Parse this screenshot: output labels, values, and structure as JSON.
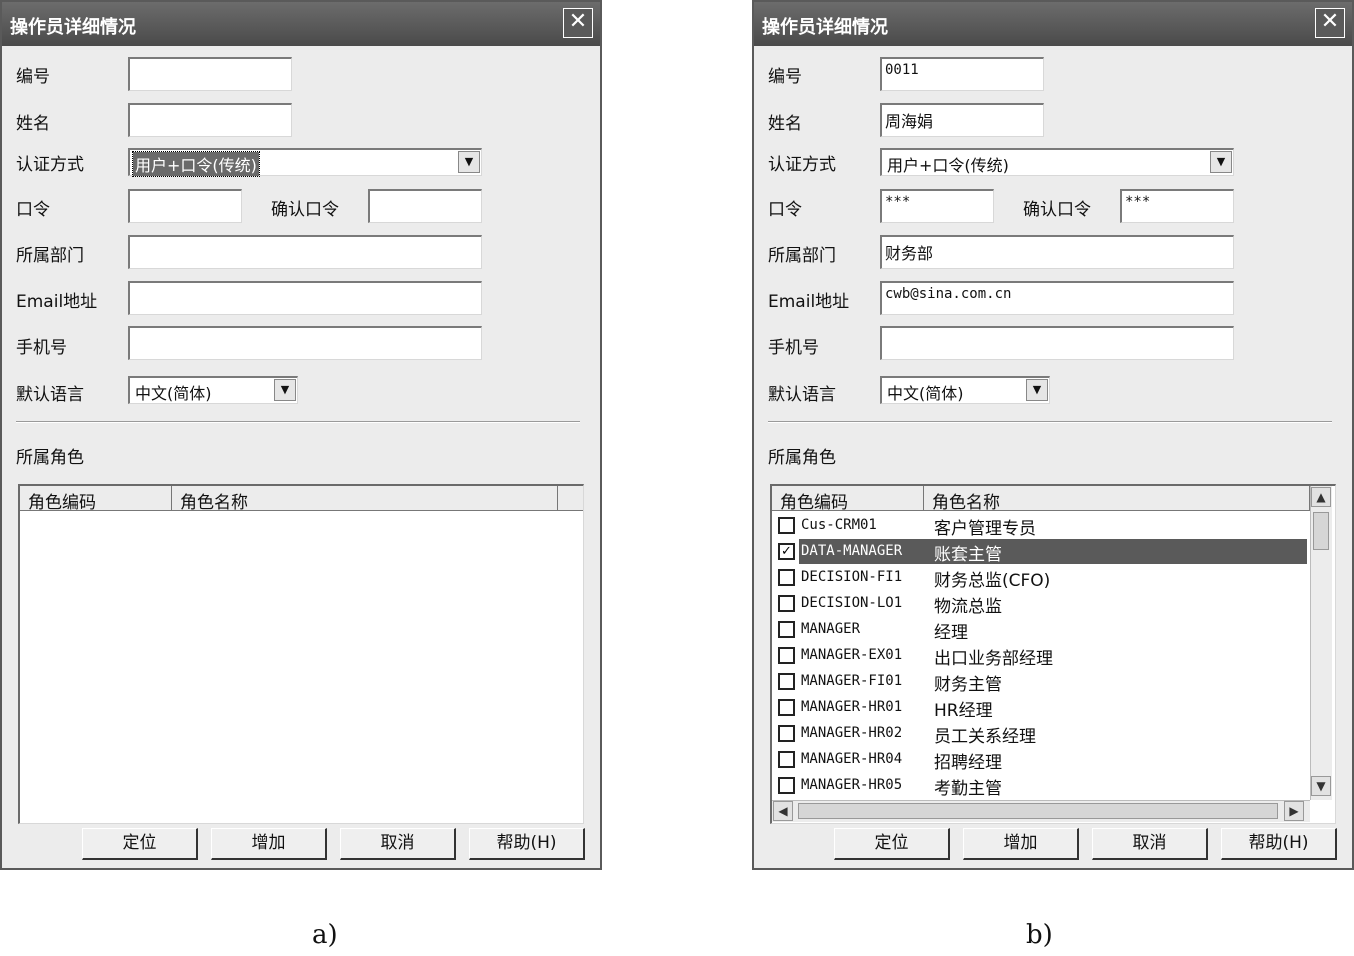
{
  "dialog_a": {
    "title": "操作员详细情况",
    "close_glyph": "✕",
    "labels": {
      "id": "编号",
      "name": "姓名",
      "auth": "认证方式",
      "password": "口令",
      "confirm": "确认口令",
      "dept": "所属部门",
      "email": "Email地址",
      "mobile": "手机号",
      "language": "默认语言",
      "roles": "所属角色"
    },
    "values": {
      "id": "",
      "name": "",
      "auth": "用户+口令(传统)",
      "password": "",
      "confirm": "",
      "dept": "",
      "email": "",
      "mobile": "",
      "language": "中文(简体)"
    },
    "columns": [
      "角色编码",
      "角色名称"
    ],
    "buttons": [
      "定位",
      "增加",
      "取消",
      "帮助(H)"
    ],
    "caption": "a)"
  },
  "dialog_b": {
    "title": "操作员详细情况",
    "close_glyph": "✕",
    "labels": {
      "id": "编号",
      "name": "姓名",
      "auth": "认证方式",
      "password": "口令",
      "confirm": "确认口令",
      "dept": "所属部门",
      "email": "Email地址",
      "mobile": "手机号",
      "language": "默认语言",
      "roles": "所属角色"
    },
    "values": {
      "id": "0011",
      "name": "周海娟",
      "auth": "用户+口令(传统)",
      "password": "***",
      "confirm": "***",
      "dept": "财务部",
      "email": "cwb@sina.com.cn",
      "mobile": "",
      "language": "中文(简体)"
    },
    "columns": [
      "角色编码",
      "角色名称"
    ],
    "roles": [
      {
        "code": "Cus-CRM01",
        "name": "客户管理专员",
        "checked": false
      },
      {
        "code": "DATA-MANAGER",
        "name": "账套主管",
        "checked": true
      },
      {
        "code": "DECISION-FI1",
        "name": "财务总监(CFO)",
        "checked": false
      },
      {
        "code": "DECISION-LO1",
        "name": "物流总监",
        "checked": false
      },
      {
        "code": "MANAGER",
        "name": "经理",
        "checked": false
      },
      {
        "code": "MANAGER-EX01",
        "name": "出口业务部经理",
        "checked": false
      },
      {
        "code": "MANAGER-FI01",
        "name": "财务主管",
        "checked": false
      },
      {
        "code": "MANAGER-HR01",
        "name": "HR经理",
        "checked": false
      },
      {
        "code": "MANAGER-HR02",
        "name": "员工关系经理",
        "checked": false
      },
      {
        "code": "MANAGER-HR04",
        "name": "招聘经理",
        "checked": false
      },
      {
        "code": "MANAGER-HR05",
        "name": "考勤主管",
        "checked": false
      }
    ],
    "buttons": [
      "定位",
      "增加",
      "取消",
      "帮助(H)"
    ],
    "caption": "b)"
  }
}
